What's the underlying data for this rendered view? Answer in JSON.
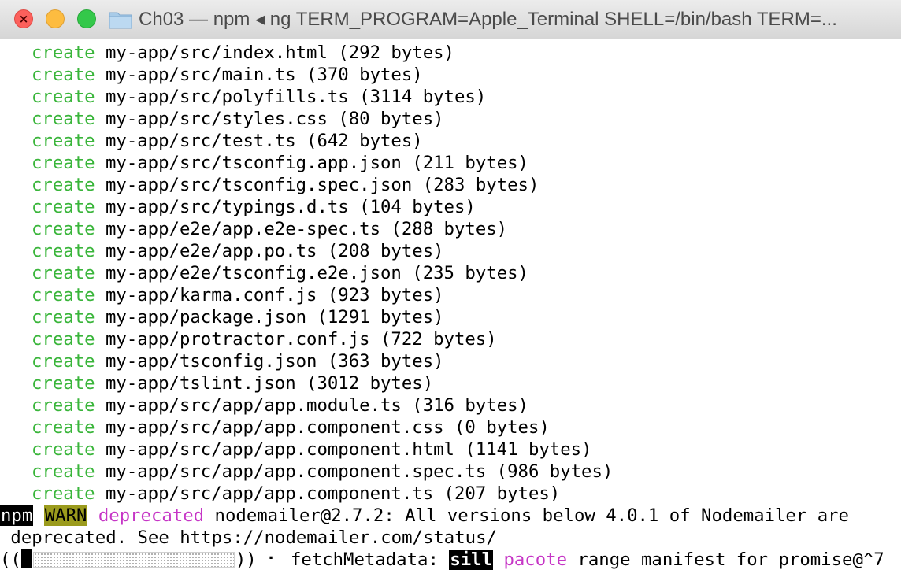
{
  "window": {
    "title": "Ch03 — npm ◂ ng TERM_PROGRAM=Apple_Terminal SHELL=/bin/bash TERM=...",
    "icons": {
      "close": "close-icon",
      "minimize": "minimize-icon",
      "zoom": "zoom-icon",
      "folder": "folder-icon"
    }
  },
  "colors": {
    "create_green": "#39b53a",
    "magenta": "#c636c6",
    "warn_bg": "#9b9b1d",
    "close_red": "#fc605c",
    "minimize_yellow": "#fdbc40",
    "zoom_green": "#34c84a"
  },
  "terminal": {
    "create_lines": [
      {
        "keyword": "create",
        "path": "my-app/src/index.html (292 bytes)"
      },
      {
        "keyword": "create",
        "path": "my-app/src/main.ts (370 bytes)"
      },
      {
        "keyword": "create",
        "path": "my-app/src/polyfills.ts (3114 bytes)"
      },
      {
        "keyword": "create",
        "path": "my-app/src/styles.css (80 bytes)"
      },
      {
        "keyword": "create",
        "path": "my-app/src/test.ts (642 bytes)"
      },
      {
        "keyword": "create",
        "path": "my-app/src/tsconfig.app.json (211 bytes)"
      },
      {
        "keyword": "create",
        "path": "my-app/src/tsconfig.spec.json (283 bytes)"
      },
      {
        "keyword": "create",
        "path": "my-app/src/typings.d.ts (104 bytes)"
      },
      {
        "keyword": "create",
        "path": "my-app/e2e/app.e2e-spec.ts (288 bytes)"
      },
      {
        "keyword": "create",
        "path": "my-app/e2e/app.po.ts (208 bytes)"
      },
      {
        "keyword": "create",
        "path": "my-app/e2e/tsconfig.e2e.json (235 bytes)"
      },
      {
        "keyword": "create",
        "path": "my-app/karma.conf.js (923 bytes)"
      },
      {
        "keyword": "create",
        "path": "my-app/package.json (1291 bytes)"
      },
      {
        "keyword": "create",
        "path": "my-app/protractor.conf.js (722 bytes)"
      },
      {
        "keyword": "create",
        "path": "my-app/tsconfig.json (363 bytes)"
      },
      {
        "keyword": "create",
        "path": "my-app/tslint.json (3012 bytes)"
      },
      {
        "keyword": "create",
        "path": "my-app/src/app/app.module.ts (316 bytes)"
      },
      {
        "keyword": "create",
        "path": "my-app/src/app/app.component.css (0 bytes)"
      },
      {
        "keyword": "create",
        "path": "my-app/src/app/app.component.html (1141 bytes)"
      },
      {
        "keyword": "create",
        "path": "my-app/src/app/app.component.spec.ts (986 bytes)"
      },
      {
        "keyword": "create",
        "path": "my-app/src/app/app.component.ts (207 bytes)"
      }
    ],
    "warn_line": {
      "npm": "npm",
      "warn": "WARN",
      "deprecated": "deprecated",
      "message": "nodemailer@2.7.2: All versions below 4.0.1 of Nodemailer are",
      "continuation": " deprecated. See https://nodemailer.com/status/"
    },
    "progress_line": {
      "open": "((",
      "close": "))",
      "spinner": "⠂",
      "task": "fetchMetadata:",
      "sill": "sill",
      "pacote": "pacote",
      "rest": "range manifest for promise@^7",
      "progress_fraction": 0.05
    }
  }
}
